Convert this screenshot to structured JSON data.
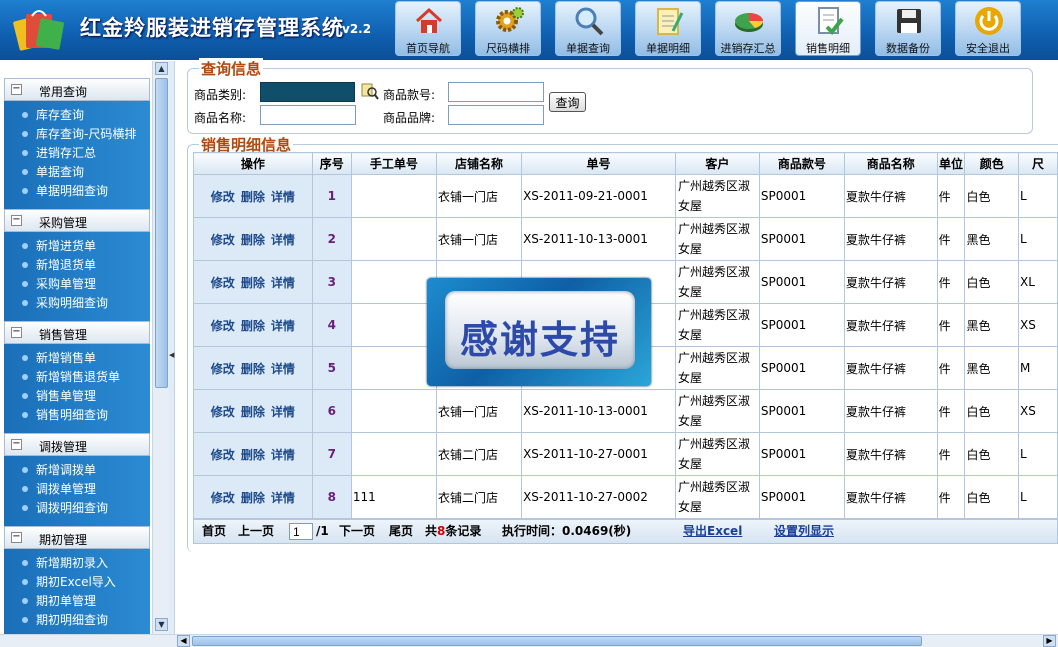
{
  "header": {
    "title": "红金羚服装进销存管理系统",
    "version": "v2.2",
    "nav": [
      {
        "label": "首页导航",
        "icon": "home-icon",
        "color": "#d63a2a"
      },
      {
        "label": "尺码横排",
        "icon": "gear-icon",
        "color": "#e0a020"
      },
      {
        "label": "单据查询",
        "icon": "magnifier-icon",
        "color": "#4a7fb8"
      },
      {
        "label": "单据明细",
        "icon": "notepad-icon",
        "color": "#d9b84a"
      },
      {
        "label": "进销存汇总",
        "icon": "pie-chart-icon",
        "color": "#3fa34d"
      },
      {
        "label": "销售明细",
        "icon": "document-check-icon",
        "color": "#3fa34d"
      },
      {
        "label": "数据备份",
        "icon": "floppy-disk-icon",
        "color": "#333333"
      },
      {
        "label": "安全退出",
        "icon": "power-icon",
        "color": "#e8a800"
      }
    ]
  },
  "sidebar": {
    "sections": [
      {
        "title": "常用查询",
        "items": [
          "库存查询",
          "库存查询-尺码横排",
          "进销存汇总",
          "单据查询",
          "单据明细查询"
        ]
      },
      {
        "title": "采购管理",
        "items": [
          "新增进货单",
          "新增退货单",
          "采购单管理",
          "采购明细查询"
        ]
      },
      {
        "title": "销售管理",
        "items": [
          "新增销售单",
          "新增销售退货单",
          "销售单管理",
          "销售明细查询"
        ]
      },
      {
        "title": "调拨管理",
        "items": [
          "新增调拨单",
          "调拨单管理",
          "调拨明细查询"
        ]
      },
      {
        "title": "期初管理",
        "items": [
          "新增期初录入",
          "期初Excel导入",
          "期初单管理",
          "期初明细查询"
        ]
      }
    ]
  },
  "query": {
    "legend": "查询信息",
    "category_label": "商品类别:",
    "code_label": "商品款号:",
    "name_label": "商品名称:",
    "brand_label": "商品品牌:",
    "search_button": "查询",
    "category_value": "",
    "code_value": "",
    "name_value": "",
    "brand_value": ""
  },
  "detail": {
    "legend": "销售明细信息",
    "columns": [
      "操作",
      "序号",
      "手工单号",
      "店铺名称",
      "单号",
      "客户",
      "商品款号",
      "商品名称",
      "单位",
      "颜色",
      "尺"
    ],
    "actions": [
      "修改",
      "删除",
      "详情"
    ],
    "rows": [
      {
        "no": "1",
        "manual": "",
        "shop": "衣铺一门店",
        "order": "XS-2011-09-21-0001",
        "customer": "广州越秀区淑女屋",
        "code": "SP0001",
        "name": "夏款牛仔裤",
        "unit": "件",
        "color": "白色",
        "size": "L"
      },
      {
        "no": "2",
        "manual": "",
        "shop": "衣铺一门店",
        "order": "XS-2011-10-13-0001",
        "customer": "广州越秀区淑女屋",
        "code": "SP0001",
        "name": "夏款牛仔裤",
        "unit": "件",
        "color": "黑色",
        "size": "L"
      },
      {
        "no": "3",
        "manual": "",
        "shop": "",
        "order": "",
        "customer": "广州越秀区淑女屋",
        "code": "SP0001",
        "name": "夏款牛仔裤",
        "unit": "件",
        "color": "白色",
        "size": "XL"
      },
      {
        "no": "4",
        "manual": "",
        "shop": "",
        "order": "",
        "customer": "广州越秀区淑女屋",
        "code": "SP0001",
        "name": "夏款牛仔裤",
        "unit": "件",
        "color": "黑色",
        "size": "XS"
      },
      {
        "no": "5",
        "manual": "",
        "shop": "",
        "order": "",
        "customer": "广州越秀区淑女屋",
        "code": "SP0001",
        "name": "夏款牛仔裤",
        "unit": "件",
        "color": "黑色",
        "size": "M"
      },
      {
        "no": "6",
        "manual": "",
        "shop": "衣铺一门店",
        "order": "XS-2011-10-13-0001",
        "customer": "广州越秀区淑女屋",
        "code": "SP0001",
        "name": "夏款牛仔裤",
        "unit": "件",
        "color": "白色",
        "size": "XS"
      },
      {
        "no": "7",
        "manual": "",
        "shop": "衣铺二门店",
        "order": "XS-2011-10-27-0001",
        "customer": "广州越秀区淑女屋",
        "code": "SP0001",
        "name": "夏款牛仔裤",
        "unit": "件",
        "color": "白色",
        "size": "L"
      },
      {
        "no": "8",
        "manual": "111",
        "shop": "衣铺二门店",
        "order": "XS-2011-10-27-0002",
        "customer": "广州越秀区淑女屋",
        "code": "SP0001",
        "name": "夏款牛仔裤",
        "unit": "件",
        "color": "白色",
        "size": "L"
      }
    ]
  },
  "pager": {
    "first": "首页",
    "prev": "上一页",
    "page_value": "1",
    "page_total": "/1",
    "next": "下一页",
    "last": "尾页",
    "total_prefix": "共",
    "total_count": "8",
    "total_suffix": "条记录",
    "exec_time": "执行时间：0.0469(秒)",
    "export": "导出Excel",
    "columns_setting": "设置列显示"
  },
  "overlay": {
    "text": "感谢支持"
  }
}
